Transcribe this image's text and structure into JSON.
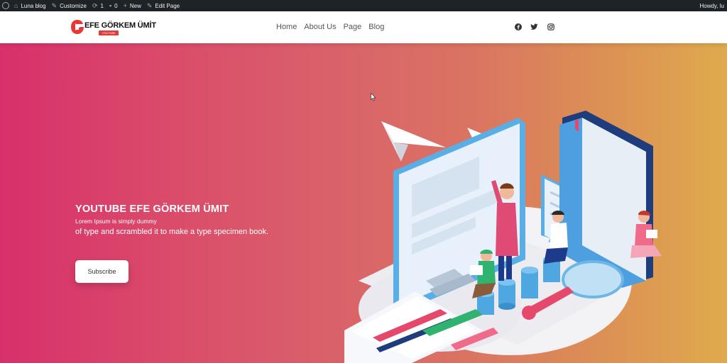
{
  "adminbar": {
    "site_name": "Luna blog",
    "customize": "Customize",
    "updates_count": "1",
    "comments_count": "0",
    "new_label": "New",
    "edit_page": "Edit Page",
    "howdy": "Howdy, lu"
  },
  "header": {
    "logo_text": "EFE GÖRKEM ÜMİT",
    "logo_badge": "YOUTUBE",
    "nav": [
      "Home",
      "About Us",
      "Page",
      "Blog"
    ],
    "social_icons": [
      "facebook-icon",
      "twitter-icon",
      "instagram-icon"
    ]
  },
  "hero": {
    "title": "YOUTUBE EFE GÖRKEM ÜMIT",
    "subtitle_small": "Lorem Ipsum is simply dummy",
    "subtitle": "of type and scrambled it to make a type specimen book.",
    "button": "Subscribe"
  },
  "colors": {
    "adminbar_bg": "#1d2327",
    "hero_gradient_start": "#d8306b",
    "hero_gradient_end": "#dfaa4d",
    "logo_red": "#e53935"
  }
}
